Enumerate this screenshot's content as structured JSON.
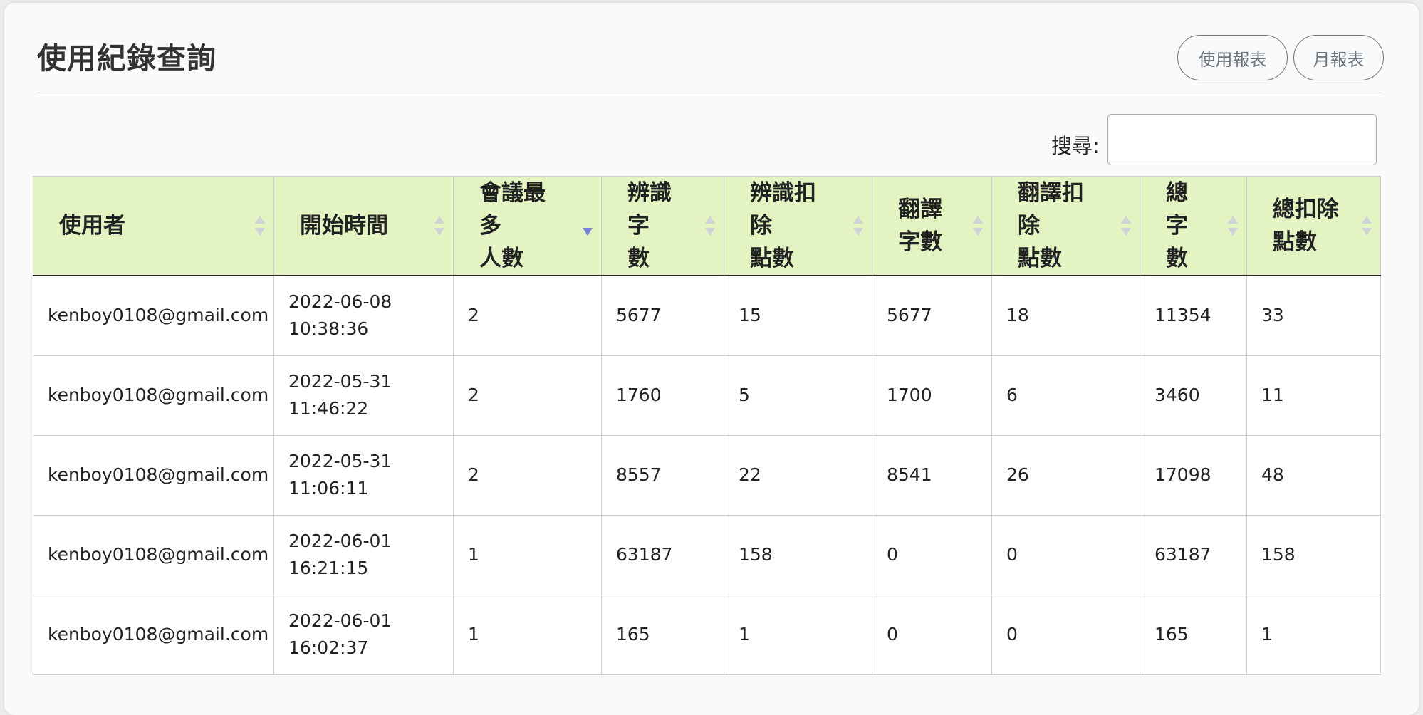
{
  "page": {
    "title": "使用紀錄查詢",
    "buttons": {
      "usage_report": "使用報表",
      "monthly_report": "月報表"
    },
    "search": {
      "label": "搜尋:",
      "value": ""
    }
  },
  "table": {
    "headers": {
      "user": [
        "使用者"
      ],
      "start_time": [
        "開始時間"
      ],
      "max_participants": [
        "會議最多",
        "人數"
      ],
      "recognition_chars": [
        "辨識字",
        "數"
      ],
      "recognition_points": [
        "辨識扣除",
        "點數"
      ],
      "translation_chars": [
        "翻譯",
        "字數"
      ],
      "translation_points": [
        "翻譯扣除",
        "點數"
      ],
      "total_chars": [
        "總字",
        "數"
      ],
      "total_points": [
        "總扣除",
        "點數"
      ]
    },
    "sorted_column": "max_participants",
    "sort_direction": "desc",
    "rows": [
      {
        "user": "kenboy0108@gmail.com",
        "date": "2022-06-08",
        "time": "10:38:36",
        "max_participants": "2",
        "recognition_chars": "5677",
        "recognition_points": "15",
        "translation_chars": "5677",
        "translation_points": "18",
        "total_chars": "11354",
        "total_points": "33"
      },
      {
        "user": "kenboy0108@gmail.com",
        "date": "2022-05-31",
        "time": "11:46:22",
        "max_participants": "2",
        "recognition_chars": "1760",
        "recognition_points": "5",
        "translation_chars": "1700",
        "translation_points": "6",
        "total_chars": "3460",
        "total_points": "11"
      },
      {
        "user": "kenboy0108@gmail.com",
        "date": "2022-05-31",
        "time": "11:06:11",
        "max_participants": "2",
        "recognition_chars": "8557",
        "recognition_points": "22",
        "translation_chars": "8541",
        "translation_points": "26",
        "total_chars": "17098",
        "total_points": "48"
      },
      {
        "user": "kenboy0108@gmail.com",
        "date": "2022-06-01",
        "time": "16:21:15",
        "max_participants": "1",
        "recognition_chars": "63187",
        "recognition_points": "158",
        "translation_chars": "0",
        "translation_points": "0",
        "total_chars": "63187",
        "total_points": "158"
      },
      {
        "user": "kenboy0108@gmail.com",
        "date": "2022-06-01",
        "time": "16:02:37",
        "max_participants": "1",
        "recognition_chars": "165",
        "recognition_points": "1",
        "translation_chars": "0",
        "translation_points": "0",
        "total_chars": "165",
        "total_points": "1"
      }
    ]
  }
}
